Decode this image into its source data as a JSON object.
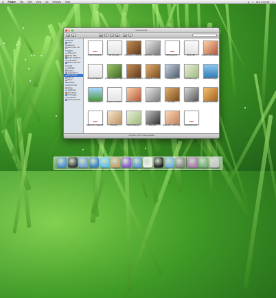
{
  "menubar": {
    "apple": "",
    "app": "Finder",
    "items": [
      "File",
      "Edit",
      "View",
      "Go",
      "Window",
      "Help"
    ],
    "clock": "Mon 8:00 PM"
  },
  "window": {
    "title": "Documents",
    "search_placeholder": "",
    "status": "45 items, 46.33 GB available"
  },
  "sidebar": {
    "sections": [
      {
        "head": "DEVICES",
        "items": [
          {
            "label": "iDisk"
          },
          {
            "label": "Network"
          },
          {
            "label": "Macintosh HD"
          }
        ]
      },
      {
        "head": "SHARED",
        "items": [
          {
            "label": "Alfa Laser"
          },
          {
            "label": "Bob's iMac"
          },
          {
            "label": "Bob's MacBook"
          },
          {
            "label": "Judy's Mini"
          },
          {
            "label": "Studio Mac Pro"
          }
        ]
      },
      {
        "head": "PLACES",
        "items": [
          {
            "label": "Desktop"
          },
          {
            "label": "bettina"
          },
          {
            "label": "Applications"
          },
          {
            "label": "Documents",
            "selected": true
          },
          {
            "label": "Movies"
          },
          {
            "label": "Music"
          },
          {
            "label": "Pictures"
          }
        ]
      },
      {
        "head": "SEARCH FOR",
        "items": [
          {
            "label": "Today"
          },
          {
            "label": "Yesterday"
          },
          {
            "label": "Past Week"
          },
          {
            "label": "All Images"
          },
          {
            "label": "All Movies"
          },
          {
            "label": "All Documents"
          }
        ]
      }
    ]
  },
  "files": [
    {
      "name": "Client Schedule",
      "kind": "doc",
      "label": "DOC"
    },
    {
      "name": "Da Vinci.pdf",
      "kind": "doc2"
    },
    {
      "name": "Donny Co - in Mexico",
      "kind": "photo-a"
    },
    {
      "name": "DMA Chor...daddress",
      "kind": "photo-b"
    },
    {
      "name": "Estimate.pdf",
      "kind": "pdf",
      "label": "PDF"
    },
    {
      "name": "EXLA 240",
      "kind": "doc2"
    },
    {
      "name": "Evelyn's birthday.jpg",
      "kind": "photo-c"
    },
    {
      "name": "Family Budget.xls",
      "kind": "doc2"
    },
    {
      "name": "Farmers Market Flight",
      "kind": "photo-d"
    },
    {
      "name": "Fun and Games.keynote",
      "kind": "photo-a"
    },
    {
      "name": "Garage R...ion.pptx",
      "kind": "photo-e"
    },
    {
      "name": "Garage.psd",
      "kind": "photo-f"
    },
    {
      "name": "Gettysburg.gif",
      "kind": "map"
    },
    {
      "name": "Grand Bahia.jpg",
      "kind": "photo-g"
    },
    {
      "name": "Hawaii Travel",
      "kind": "photo-h"
    },
    {
      "name": "Ice Shell: Antarctica",
      "kind": "doc2"
    },
    {
      "name": "Kauai trip.numbers",
      "kind": "photo-c"
    },
    {
      "name": "Komodo.movie",
      "kind": "photo-b"
    },
    {
      "name": "Lion.jpg",
      "kind": "photo-e"
    },
    {
      "name": "London Trains",
      "kind": "photo-i"
    },
    {
      "name": "Mango Pancakes",
      "kind": "photo-j"
    },
    {
      "name": "Martin's S... Sale.pdf",
      "kind": "pdf",
      "label": "PDF"
    },
    {
      "name": "Mao.jpg",
      "kind": "photo-k"
    },
    {
      "name": "Map Travel.jpg",
      "kind": "map"
    },
    {
      "name": "Mis.mp4",
      "kind": "photo-l"
    },
    {
      "name": "Nina_and_...2007.jpg",
      "kind": "photo-m"
    },
    {
      "name": "Paris Metro.pdf",
      "kind": "pdf",
      "label": "PDF"
    }
  ],
  "dock": {
    "items": [
      "finder-icon",
      "dashboard-icon",
      "mail-icon",
      "safari-icon",
      "ichat-icon",
      "address-book-icon",
      "itunes-icon",
      "iphoto-icon",
      "ical-icon",
      "photo-booth-icon",
      "preview-icon",
      "system-preferences-icon",
      "documents-stack-icon",
      "downloads-stack-icon",
      "trash-icon"
    ]
  },
  "colors": {
    "selection": "#3d75c9",
    "grass_light": "#7fcf4a",
    "grass_dark": "#1f5e17"
  }
}
